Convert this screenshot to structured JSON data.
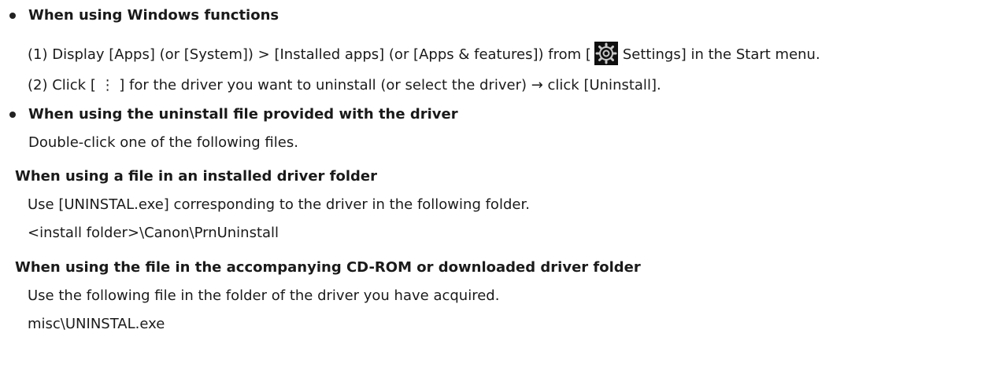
{
  "sections": [
    {
      "heading": "When using Windows functions",
      "steps": [
        {
          "before_icon": "(1) Display [Apps] (or [System]) > [Installed apps] (or [Apps & features]) from [",
          "icon": "gear-icon",
          "after_icon": "Settings] in the Start menu."
        },
        {
          "text": "(2) Click [ ⋮ ] for the driver you want to uninstall (or select the driver) → click [Uninstall]."
        }
      ]
    },
    {
      "heading": "When using the uninstall file provided with the driver",
      "intro": "Double-click one of the following files.",
      "subsections": [
        {
          "title": "When using a file in an installed driver folder",
          "description": "Use [UNINSTAL.exe] corresponding to the driver in the following folder.",
          "path": "<install folder>\\Canon\\PrnUninstall"
        },
        {
          "title": "When using the file in the accompanying CD-ROM or downloaded driver folder",
          "description": "Use the following file in the folder of the driver you have acquired.",
          "path": "misc\\UNINSTAL.exe"
        }
      ]
    }
  ],
  "colors": {
    "text": "#1a1a1a",
    "icon_background": "#0f0f0f",
    "icon_foreground": "#c8c8c8"
  }
}
